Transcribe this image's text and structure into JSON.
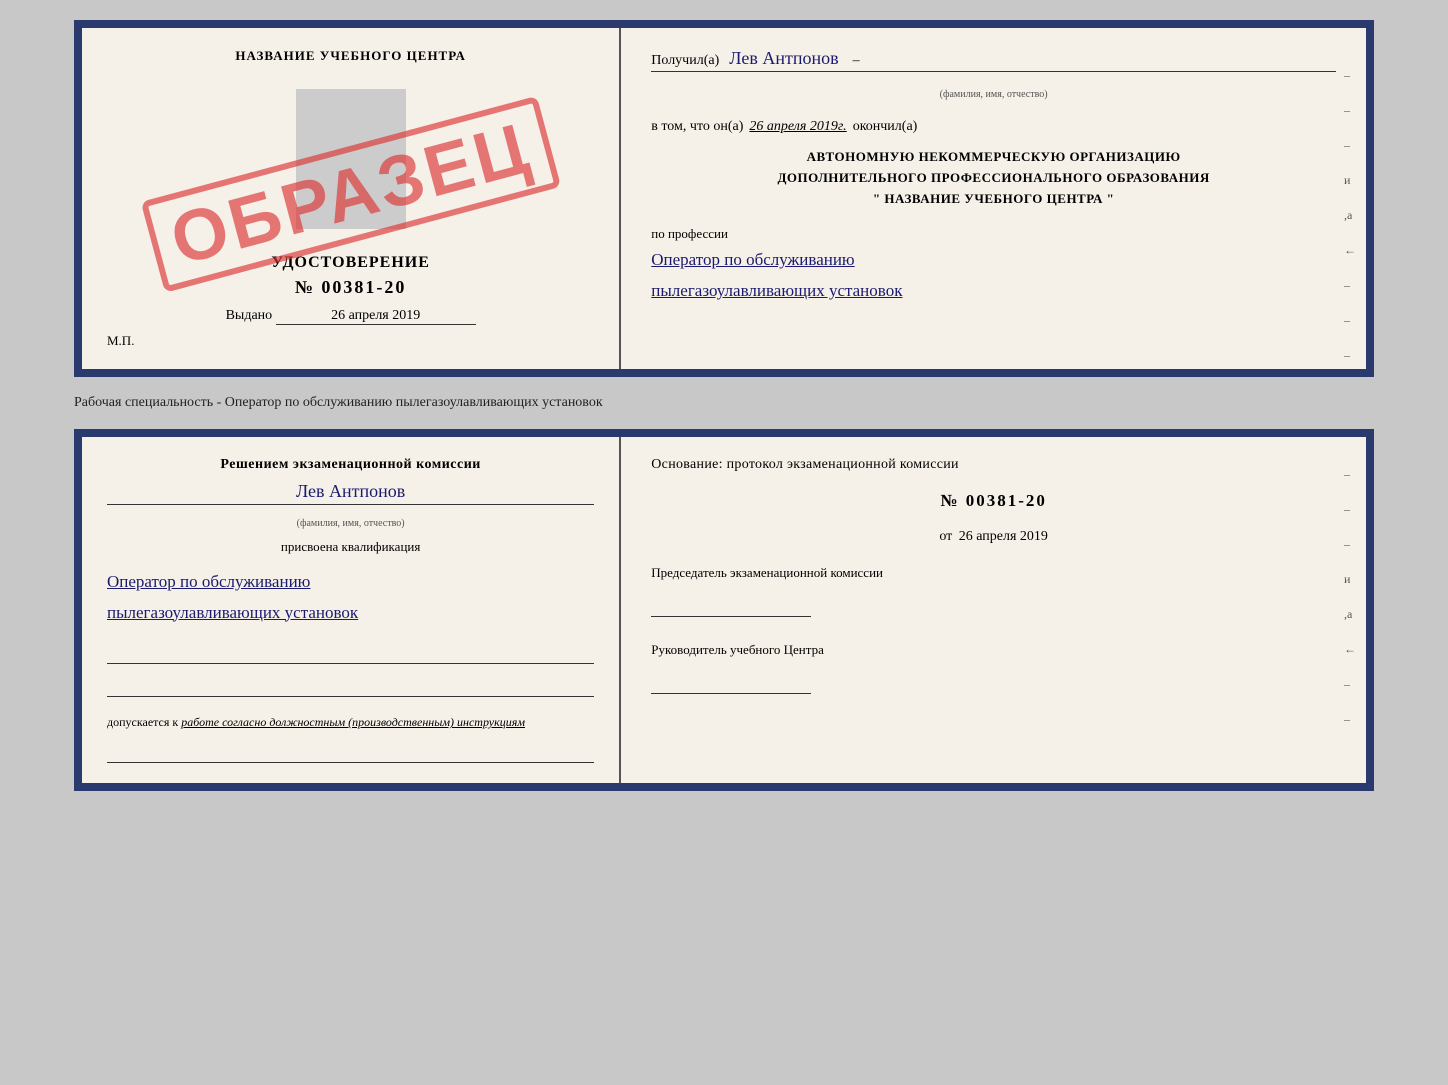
{
  "top_doc": {
    "left": {
      "title": "НАЗВАНИЕ УЧЕБНОГО ЦЕНТРА",
      "cert_label": "УДОСТОВЕРЕНИЕ",
      "cert_number": "№ 00381-20",
      "issued": "Выдано",
      "issued_date": "26 апреля 2019",
      "mp": "М.П.",
      "stamp": "ОБРАЗЕЦ"
    },
    "right": {
      "received_prefix": "Получил(а)",
      "received_name": "Лев Антпонов",
      "name_subtext": "(фамилия, имя, отчество)",
      "completed_prefix": "в том, что он(а)",
      "completed_date": "26 апреля 2019г.",
      "completed_suffix": "окончил(а)",
      "org_line1": "АВТОНОМНУЮ НЕКОММЕРЧЕСКУЮ ОРГАНИЗАЦИЮ",
      "org_line2": "ДОПОЛНИТЕЛЬНОГО ПРОФЕССИОНАЛЬНОГО ОБРАЗОВАНИЯ",
      "org_line3": "\"  НАЗВАНИЕ УЧЕБНОГО ЦЕНТРА  \"",
      "profession_label": "по профессии",
      "profession_line1": "Оператор по обслуживанию",
      "profession_line2": "пылегазоулавливающих установок",
      "dash1": "–",
      "dash2": "–",
      "dash3": "–",
      "dash4": "и",
      "dash5": ",а",
      "dash6": "←",
      "dash7": "–",
      "dash8": "–",
      "dash9": "–"
    }
  },
  "separator": {
    "text": "Рабочая специальность - Оператор по обслуживанию пылегазоулавливающих установок"
  },
  "bottom_doc": {
    "left": {
      "commission_text": "Решением экзаменационной комиссии",
      "name": "Лев Антпонов",
      "name_subtext": "(фамилия, имя, отчество)",
      "assigned_label": "присвоена квалификация",
      "qualification_line1": "Оператор по обслуживанию",
      "qualification_line2": "пылегазоулавливающих установок",
      "допускается_prefix": "допускается к",
      "допускается_text": "работе согласно должностным (производственным) инструкциям"
    },
    "right": {
      "osnov_text": "Основание: протокол экзаменационной комиссии",
      "protocol_number": "№  00381-20",
      "from_prefix": "от",
      "from_date": "26 апреля 2019",
      "chairman_label": "Председатель экзаменационной комиссии",
      "director_label": "Руководитель учебного Центра",
      "dash1": "–",
      "dash2": "–",
      "dash3": "–",
      "dash4": "и",
      "dash5": ",а",
      "dash6": "←",
      "dash7": "–",
      "dash8": "–"
    }
  }
}
